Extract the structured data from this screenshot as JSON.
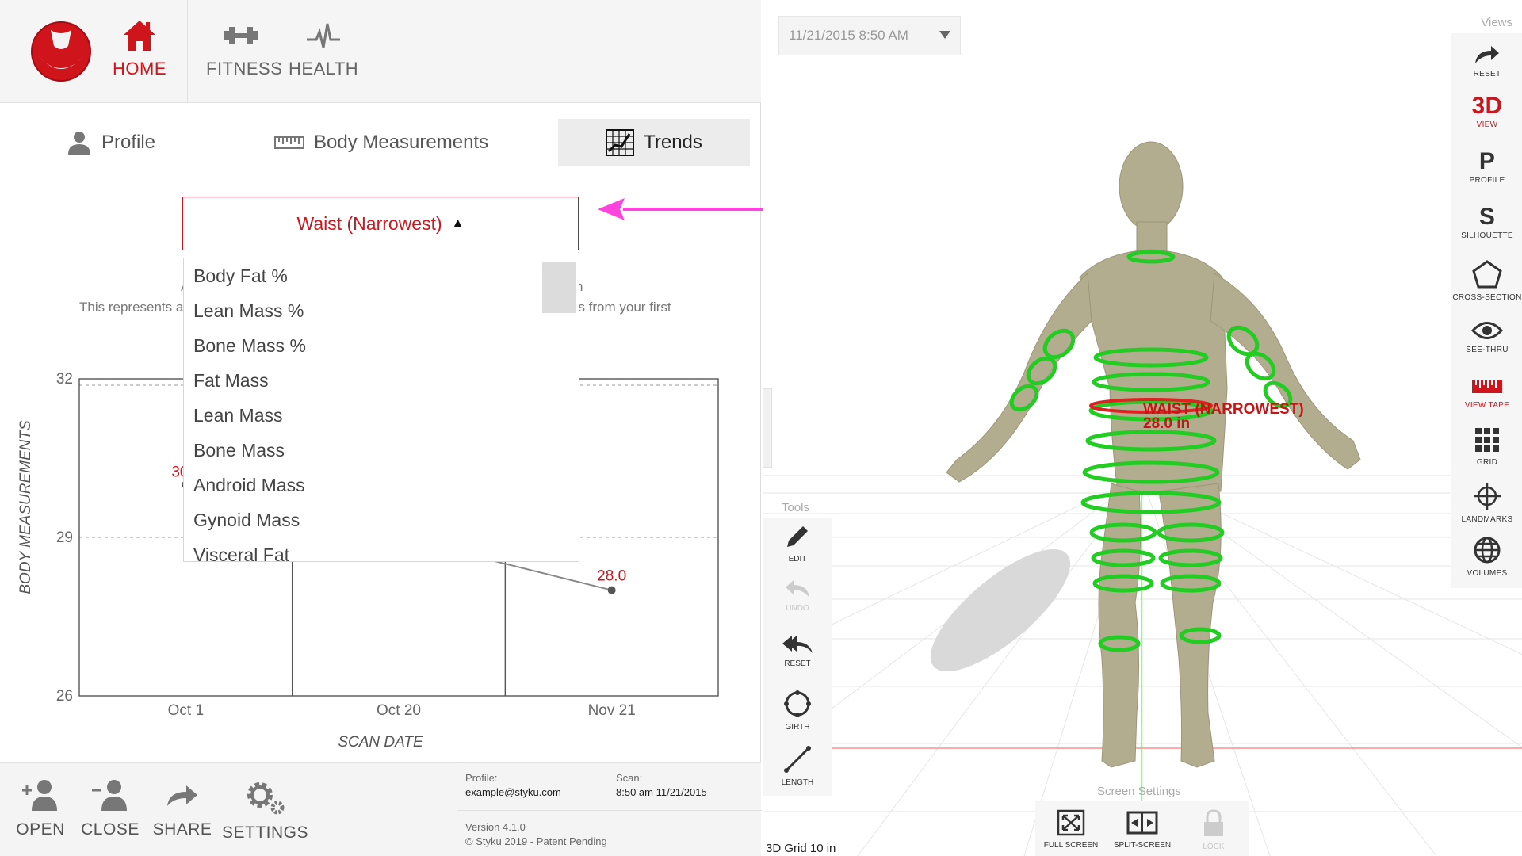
{
  "nav": {
    "items": [
      {
        "label": "HOME"
      },
      {
        "label": "FITNESS"
      },
      {
        "label": "HEALTH"
      }
    ]
  },
  "tabs": [
    {
      "label": "Profile"
    },
    {
      "label": "Body Measurements"
    },
    {
      "label": "Trends"
    }
  ],
  "measure_select": {
    "selected": "Waist (Narrowest)"
  },
  "description": {
    "fragment_left": "This represents a",
    "fragment_right": "es from your first",
    "fragment_a": "A",
    "fragment_n": "n"
  },
  "dropdown_options": [
    "Body Fat %",
    "Lean Mass %",
    "Bone Mass %",
    "Fat Mass",
    "Lean Mass",
    "Bone Mass",
    "Android Mass",
    "Gynoid Mass",
    "Visceral Fat"
  ],
  "chart_data": {
    "type": "line",
    "categories": [
      "Oct 1",
      "Oct 20",
      "Nov 21"
    ],
    "series": [
      {
        "values": [
          30.0,
          29.0,
          28.0
        ]
      }
    ],
    "visible_labels": [
      "30",
      "28.0"
    ],
    "xlabel": "SCAN DATE",
    "ylabel": "BODY MEASUREMENTS",
    "ylim": [
      26,
      32
    ],
    "yticks": [
      "32",
      "29",
      "26"
    ],
    "grid": true,
    "accent": "#d0141b"
  },
  "bottom": {
    "items": [
      {
        "label": "OPEN"
      },
      {
        "label": "CLOSE"
      },
      {
        "label": "SHARE"
      },
      {
        "label": "SETTINGS"
      }
    ]
  },
  "info": {
    "profile_label": "Profile:",
    "profile_value": "example@styku.com",
    "scan_label": "Scan:",
    "scan_value": "8:50 am 11/21/2015",
    "version": "Version 4.1.0",
    "copyright": "© Styku 2019 - Patent Pending"
  },
  "scan_select": {
    "value": "11/21/2015 8:50 AM"
  },
  "views": {
    "title": "Views",
    "items": [
      {
        "label": "RESET",
        "icon": "redo-arrow-icon"
      },
      {
        "label": "VIEW",
        "big": "3D"
      },
      {
        "label": "PROFILE",
        "big": "P"
      },
      {
        "label": "SILHOUETTE",
        "big": "S"
      },
      {
        "label": "CROSS-SECTION",
        "icon": "pentagon-icon"
      },
      {
        "label": "SEE-THRU",
        "icon": "eye-icon"
      },
      {
        "label": "VIEW TAPE",
        "icon": "tape-icon"
      },
      {
        "label": "GRID",
        "icon": "grid-icon"
      },
      {
        "label": "LANDMARKS",
        "icon": "crosshair-icon"
      },
      {
        "label": "VOLUMES",
        "icon": "globe-icon"
      }
    ]
  },
  "tools": {
    "title": "Tools",
    "items": [
      {
        "label": "EDIT"
      },
      {
        "label": "UNDO"
      },
      {
        "label": "RESET"
      },
      {
        "label": "GIRTH"
      },
      {
        "label": "LENGTH"
      }
    ]
  },
  "screen_settings": {
    "title": "Screen Settings",
    "items": [
      {
        "label": "FULL SCREEN"
      },
      {
        "label": "SPLIT-SCREEN"
      },
      {
        "label": "LOCK"
      }
    ]
  },
  "model": {
    "measure_label": "WAIST (NARROWEST)",
    "measure_value": "28.0 in",
    "grid_label": "3D Grid 10 in"
  },
  "colors": {
    "accent": "#d0141b",
    "ring": "#22cc22",
    "highlight_arrow": "#ff44dd",
    "body": "#b3ad90"
  }
}
